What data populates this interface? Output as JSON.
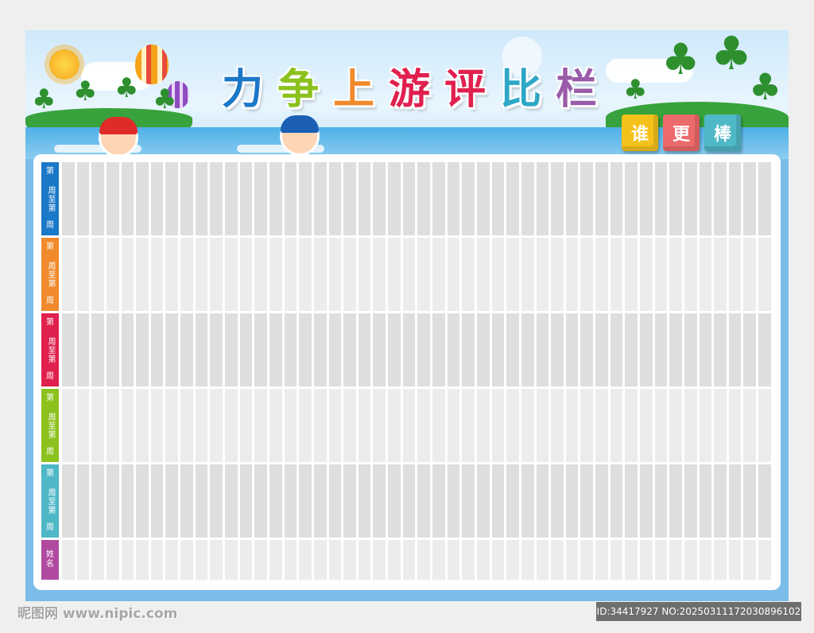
{
  "title_chars": [
    {
      "char": "力",
      "color": "#1a78c8"
    },
    {
      "char": "争",
      "color": "#8cc21e"
    },
    {
      "char": "上",
      "color": "#f08a2c"
    },
    {
      "char": "游",
      "color": "#e0204e"
    },
    {
      "char": "评",
      "color": "#e0204e"
    },
    {
      "char": "比",
      "color": "#2ea7c6"
    },
    {
      "char": "栏",
      "color": "#9a5ba8"
    }
  ],
  "badges": [
    {
      "char": "谁",
      "color": "#f5c21b"
    },
    {
      "char": "更",
      "color": "#ec6a6a"
    },
    {
      "char": "棒",
      "color": "#4fb8c6"
    }
  ],
  "period_rows": [
    {
      "lines": [
        "第",
        "周至第",
        "周"
      ],
      "color": "#1a78c8"
    },
    {
      "lines": [
        "第",
        "周至第",
        "周"
      ],
      "color": "#f08a2c"
    },
    {
      "lines": [
        "第",
        "周至第",
        "周"
      ],
      "color": "#e0204e"
    },
    {
      "lines": [
        "第",
        "周至第",
        "周"
      ],
      "color": "#8cc21e"
    },
    {
      "lines": [
        "第",
        "周至第",
        "周"
      ],
      "color": "#4fb8c6"
    }
  ],
  "name_row": {
    "lines": [
      "姓",
      "名"
    ],
    "color": "#b04aa0"
  },
  "watermark_left": "昵图网 www.nipic.com",
  "watermark_right": "ID:34417927 NO:20250311172030896102"
}
